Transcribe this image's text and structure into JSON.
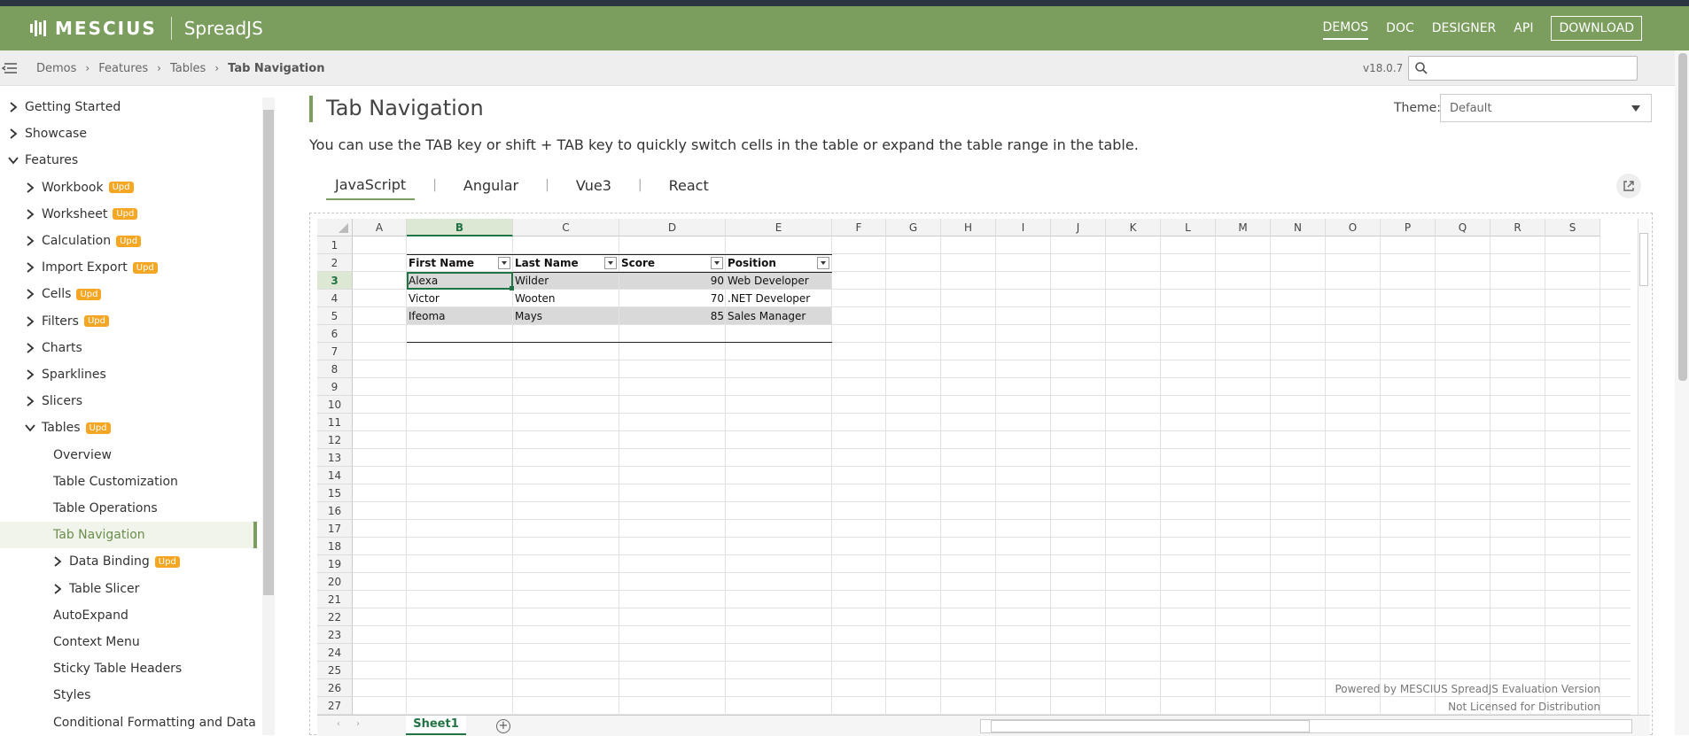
{
  "header": {
    "logo_text": "MESCIUS",
    "product": "SpreadJS",
    "nav": [
      {
        "label": "DEMOS",
        "active": true
      },
      {
        "label": "DOC",
        "active": false
      },
      {
        "label": "DESIGNER",
        "active": false
      },
      {
        "label": "API",
        "active": false
      }
    ],
    "download": "DOWNLOAD"
  },
  "breadcrumb": {
    "items": [
      "Demos",
      "Features",
      "Tables"
    ],
    "current": "Tab Navigation",
    "version": "v18.0.7",
    "search_placeholder": ""
  },
  "sidebar": {
    "badge": "Upd",
    "items": [
      {
        "label": "Getting Started",
        "level": 0,
        "chev": "right",
        "badge": false
      },
      {
        "label": "Showcase",
        "level": 0,
        "chev": "right",
        "badge": false
      },
      {
        "label": "Features",
        "level": 0,
        "chev": "down",
        "badge": false
      },
      {
        "label": "Workbook",
        "level": 1,
        "chev": "right",
        "badge": true
      },
      {
        "label": "Worksheet",
        "level": 1,
        "chev": "right",
        "badge": true
      },
      {
        "label": "Calculation",
        "level": 1,
        "chev": "right",
        "badge": true
      },
      {
        "label": "Import Export",
        "level": 1,
        "chev": "right",
        "badge": true
      },
      {
        "label": "Cells",
        "level": 1,
        "chev": "right",
        "badge": true
      },
      {
        "label": "Filters",
        "level": 1,
        "chev": "right",
        "badge": true
      },
      {
        "label": "Charts",
        "level": 1,
        "chev": "right",
        "badge": false
      },
      {
        "label": "Sparklines",
        "level": 1,
        "chev": "right",
        "badge": false
      },
      {
        "label": "Slicers",
        "level": 1,
        "chev": "right",
        "badge": false
      },
      {
        "label": "Tables",
        "level": 1,
        "chev": "down",
        "badge": true
      },
      {
        "label": "Overview",
        "level": 2,
        "chev": "",
        "badge": false
      },
      {
        "label": "Table Customization",
        "level": 2,
        "chev": "",
        "badge": false
      },
      {
        "label": "Table Operations",
        "level": 2,
        "chev": "",
        "badge": false
      },
      {
        "label": "Tab Navigation",
        "level": 2,
        "chev": "",
        "badge": false,
        "selected": true
      },
      {
        "label": "Data Binding",
        "level": 2,
        "chev": "right",
        "badge": true
      },
      {
        "label": "Table Slicer",
        "level": 2,
        "chev": "right",
        "badge": false
      },
      {
        "label": "AutoExpand",
        "level": 2,
        "chev": "",
        "badge": false
      },
      {
        "label": "Context Menu",
        "level": 2,
        "chev": "",
        "badge": false
      },
      {
        "label": "Sticky Table Headers",
        "level": 2,
        "chev": "",
        "badge": false
      },
      {
        "label": "Styles",
        "level": 2,
        "chev": "",
        "badge": false
      },
      {
        "label": "Conditional Formatting and Data",
        "level": 2,
        "chev": "",
        "badge": false
      }
    ]
  },
  "main": {
    "title": "Tab Navigation",
    "theme_label": "Theme:",
    "theme_value": "Default",
    "description": "You can use the TAB key or shift + TAB key to quickly switch cells in the table or expand the table range in the table.",
    "tabs": [
      {
        "label": "JavaScript",
        "active": true
      },
      {
        "label": "Angular",
        "active": false
      },
      {
        "label": "Vue3",
        "active": false
      },
      {
        "label": "React",
        "active": false
      }
    ]
  },
  "spreadsheet": {
    "columns": [
      "A",
      "B",
      "C",
      "D",
      "E",
      "F",
      "G",
      "H",
      "I",
      "J",
      "K",
      "L",
      "M",
      "N",
      "O",
      "P",
      "Q",
      "R",
      "S"
    ],
    "selected_column": "B",
    "selected_row": 3,
    "rows": [
      1,
      2,
      3,
      4,
      5,
      6,
      7,
      8,
      9,
      10,
      11,
      12,
      13,
      14,
      15,
      16,
      17,
      18,
      19,
      20,
      21,
      22,
      23,
      24,
      25,
      26,
      27
    ],
    "table": {
      "headers": [
        "First Name",
        "Last Name",
        "Score",
        "Position"
      ],
      "rows": [
        [
          "Alexa",
          "Wilder",
          "90",
          "Web Developer"
        ],
        [
          "Victor",
          "Wooten",
          "70",
          ".NET Developer"
        ],
        [
          "Ifeoma",
          "Mays",
          "85",
          "Sales Manager"
        ]
      ]
    },
    "sheet_tab": "Sheet1",
    "add_sheet": "+",
    "watermark": [
      "Powered by MESCIUS SpreadJS Evaluation Version",
      "Not Licensed for Distribution"
    ]
  },
  "colors": {
    "brand": "#7b9e5f",
    "excel_green": "#217346",
    "badge": "#f5a623"
  }
}
